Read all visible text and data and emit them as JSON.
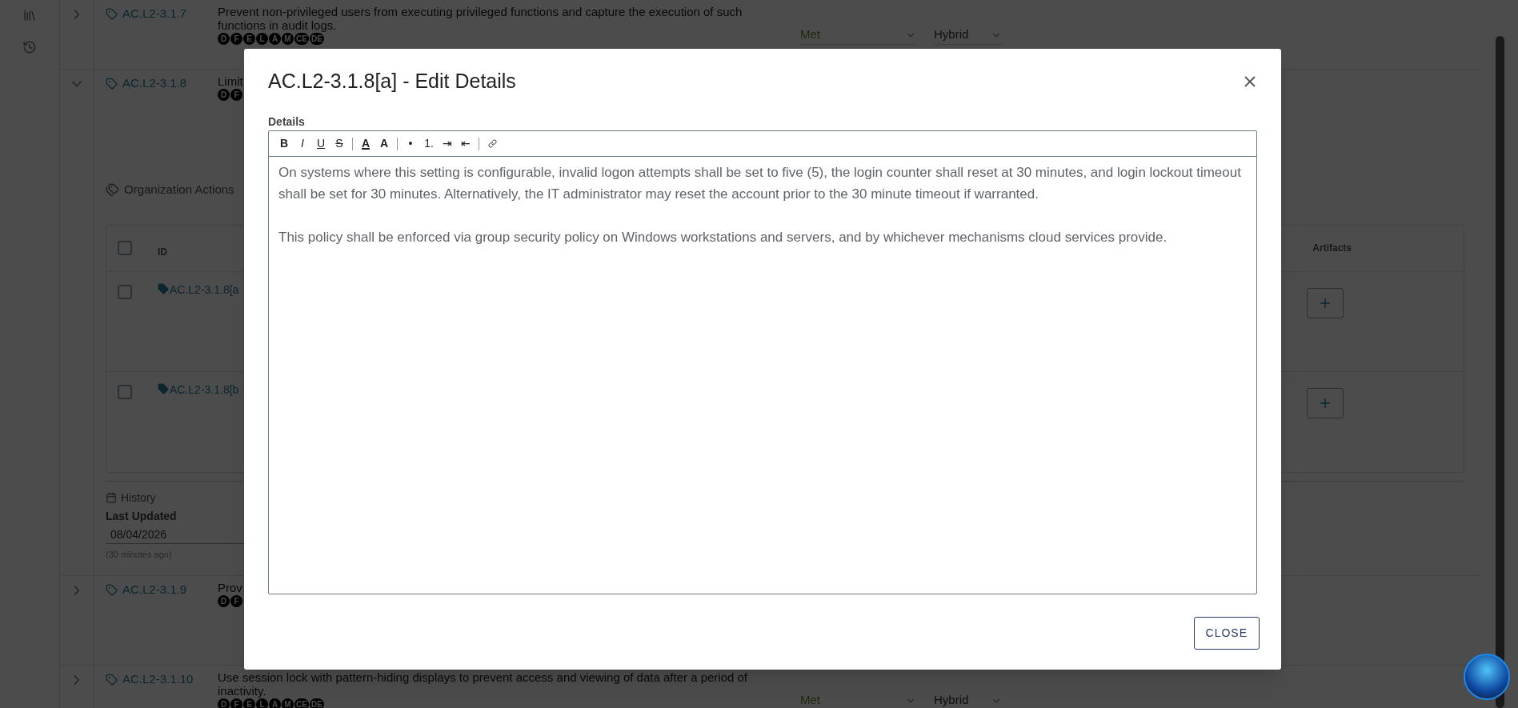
{
  "requirements": [
    {
      "id": "AC.L2-3.1.7",
      "expanded": false,
      "description": "Prevent non-privileged users from executing privileged functions and capture the execution of such functions in audit logs.",
      "badges": [
        "D",
        "F",
        "E",
        "L",
        "A",
        "M",
        "CE",
        "DE"
      ],
      "status": "Met",
      "type": "Hybrid"
    },
    {
      "id": "AC.L2-3.1.8",
      "expanded": true,
      "description": "Limit",
      "badges": [
        "D",
        "F"
      ],
      "organization_actions": {
        "title": "Organization Actions",
        "columns": [
          "ID",
          "Artifacts"
        ],
        "header_checked": false,
        "rows": [
          {
            "id": "AC.L2-3.1.8[a",
            "checked": false
          },
          {
            "id": "AC.L2-3.1.8[b",
            "checked": false
          }
        ]
      },
      "history": {
        "title": "History",
        "label": "Last Updated",
        "value": "08/04/2026",
        "relative": "(30 minutes ago)"
      }
    },
    {
      "id": "AC.L2-3.1.9",
      "expanded": false,
      "description": "Prov",
      "badges": [
        "D",
        "F"
      ]
    },
    {
      "id": "AC.L2-3.1.10",
      "expanded": false,
      "description": "Use session lock with pattern-hiding displays to prevent access and viewing of data after a period of inactivity.",
      "badges": [
        "D",
        "F",
        "E",
        "L",
        "A",
        "M",
        "CE",
        "DE"
      ],
      "status": "Met",
      "type": "Hybrid"
    }
  ],
  "dialog": {
    "title": "AC.L2-3.1.8[a] - Edit Details",
    "field_label": "Details",
    "toolbar": [
      {
        "kind": "bold",
        "label": "B"
      },
      {
        "kind": "italic",
        "label": "I"
      },
      {
        "kind": "underline",
        "label": "U"
      },
      {
        "kind": "strike",
        "label": "S"
      },
      {
        "kind": "divider"
      },
      {
        "kind": "color",
        "label": "A"
      },
      {
        "kind": "highlight",
        "label": "A"
      },
      {
        "kind": "divider"
      },
      {
        "kind": "bullet",
        "label": "•"
      },
      {
        "kind": "numbered",
        "label": "1."
      },
      {
        "kind": "indent",
        "label": "⇥"
      },
      {
        "kind": "outdent",
        "label": "⇤"
      },
      {
        "kind": "divider"
      },
      {
        "kind": "link"
      }
    ],
    "paragraphs": [
      "On systems where this setting is configurable, invalid logon attempts shall be set to five (5), the login counter shall reset at 30 minutes, and login lockout timeout shall be set for 30 minutes. Alternatively, the IT administrator may reset the account prior to the 30 minute timeout if warranted.",
      "This policy shall be enforced via group security policy on Windows workstations and servers, and by whichever mechanisms cloud services provide."
    ],
    "close_button": "CLOSE"
  }
}
